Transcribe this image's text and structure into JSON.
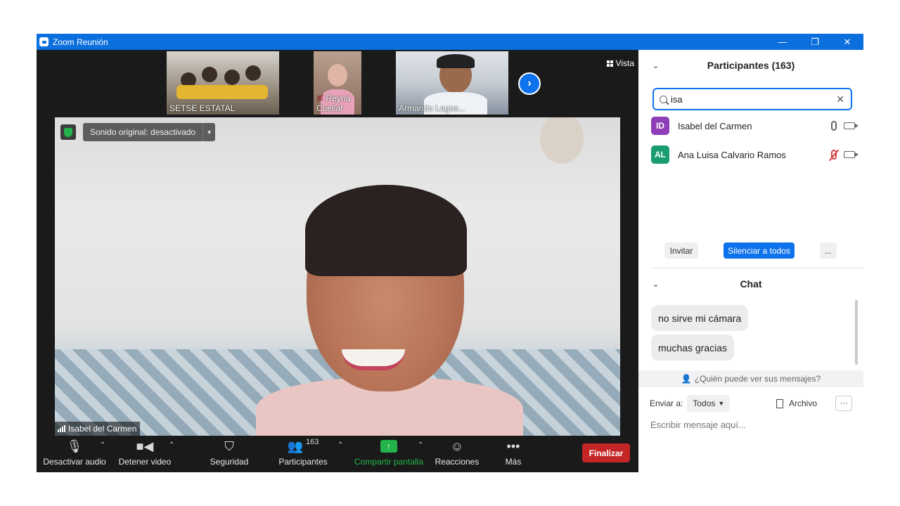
{
  "window": {
    "title": "Zoom Reunión"
  },
  "thumbnails": [
    {
      "name": "SETSE ESTATAL",
      "muted": false
    },
    {
      "name": "Reyna Cuellar",
      "muted": true
    },
    {
      "name": "Armando Lagos..."
    }
  ],
  "view_button": {
    "label": "Vista"
  },
  "main_video": {
    "sound_label": "Sonido original: desactivado",
    "speaker_name": "Isabel del Carmen"
  },
  "toolbar": {
    "audio_label": "Desactivar audio",
    "video_label": "Detener video",
    "security_label": "Seguridad",
    "participants_label": "Participantes",
    "participants_count": "163",
    "share_label": "Compartir pantalla",
    "reactions_label": "Reacciones",
    "more_label": "Más",
    "end_label": "Finalizar"
  },
  "participants_panel": {
    "title": "Participantes (163)",
    "search_value": "isa",
    "rows": [
      {
        "initials": "ID",
        "name": "Isabel del Carmen",
        "avatar_color": "#8e3fb8",
        "mic_muted": false
      },
      {
        "initials": "AL",
        "name": "Ana Luisa Calvario Ramos",
        "avatar_color": "#1a9d6f",
        "mic_muted": true
      }
    ],
    "invite_label": "Invitar",
    "mute_all_label": "Silenciar a todos",
    "more_label": "..."
  },
  "chat": {
    "title": "Chat",
    "messages": [
      {
        "text": "no sirve mi cámara"
      },
      {
        "text": "muchas gracias"
      }
    ],
    "visibility_note": "¿Quién puede ver sus mensajes?",
    "send_to_label": "Enviar a:",
    "recipient": "Todos",
    "file_label": "Archivo",
    "compose_placeholder": "Escribir mensaje aquí..."
  },
  "colors": {
    "titlebar": "#0b6fde",
    "accent": "#0e72ed",
    "end_button": "#c42525",
    "share_green": "#23b34a"
  }
}
